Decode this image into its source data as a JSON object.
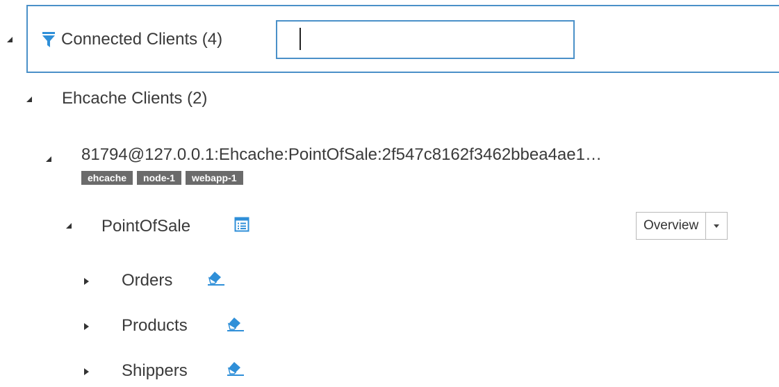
{
  "tree": {
    "root": {
      "label": "Connected Clients (4)",
      "filter_value": ""
    },
    "ehcache_clients": {
      "label": "Ehcache Clients (2)"
    },
    "client": {
      "label": "81794@127.0.0.1:Ehcache:PointOfSale:2f547c8162f3462bbea4ae1…",
      "tags": [
        "ehcache",
        "node-1",
        "webapp-1"
      ]
    },
    "cache_manager": {
      "label": "PointOfSale",
      "view_select": "Overview"
    },
    "caches": [
      {
        "label": "Orders"
      },
      {
        "label": "Products"
      },
      {
        "label": "Shippers"
      }
    ]
  },
  "colors": {
    "accent": "#4a90c8",
    "icon_blue": "#2f8fd8",
    "tag_bg": "#6b6b6b"
  },
  "icons": {
    "filter": "filter-icon",
    "details": "list-details-icon",
    "clear": "eraser-icon"
  }
}
